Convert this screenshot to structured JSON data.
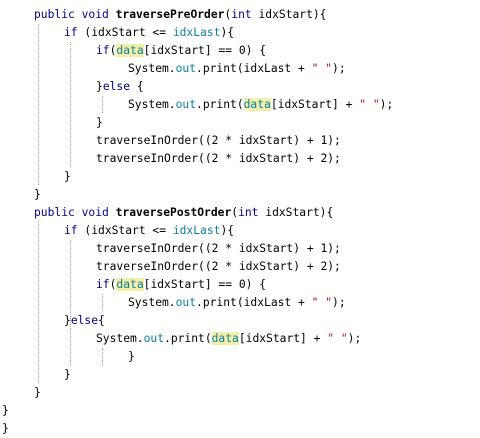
{
  "colors": {
    "keyword": "#00008b",
    "field": "#0b7fa0",
    "string": "#a31515",
    "highlight": "#f2f0a8",
    "guide": "#9a9a9a"
  },
  "code_lines": [
    {
      "indent": 34,
      "tokens": [
        {
          "t": "public void ",
          "c": "kw"
        },
        {
          "t": "traversePreOrder",
          "c": "bold"
        },
        {
          "t": "(",
          "c": ""
        },
        {
          "t": "int",
          "c": "kw"
        },
        {
          "t": " idxStart){",
          "c": ""
        }
      ]
    },
    {
      "indent": 64,
      "tokens": [
        {
          "t": "if",
          "c": "kw"
        },
        {
          "t": " (idxStart <= ",
          "c": ""
        },
        {
          "t": "idxLast",
          "c": "field"
        },
        {
          "t": "){",
          "c": ""
        }
      ]
    },
    {
      "indent": 96,
      "tokens": [
        {
          "t": "if",
          "c": "kw"
        },
        {
          "t": "(",
          "c": ""
        },
        {
          "t": "data",
          "c": "field hl"
        },
        {
          "t": "[idxStart] == 0) {",
          "c": ""
        }
      ]
    },
    {
      "indent": 128,
      "tokens": [
        {
          "t": "System.",
          "c": ""
        },
        {
          "t": "out",
          "c": "field"
        },
        {
          "t": ".print(idxLast + ",
          "c": ""
        },
        {
          "t": "\" \"",
          "c": "str"
        },
        {
          "t": ");",
          "c": ""
        }
      ]
    },
    {
      "indent": 96,
      "tokens": [
        {
          "t": "}",
          "c": ""
        },
        {
          "t": "else",
          "c": "kw"
        },
        {
          "t": " {",
          "c": ""
        }
      ]
    },
    {
      "indent": 128,
      "tokens": [
        {
          "t": "System.",
          "c": ""
        },
        {
          "t": "out",
          "c": "field"
        },
        {
          "t": ".print(",
          "c": ""
        },
        {
          "t": "data",
          "c": "field hl"
        },
        {
          "t": "[idxStart] + ",
          "c": ""
        },
        {
          "t": "\" \"",
          "c": "str"
        },
        {
          "t": ");",
          "c": ""
        }
      ]
    },
    {
      "indent": 96,
      "tokens": [
        {
          "t": "}",
          "c": ""
        }
      ]
    },
    {
      "indent": 96,
      "tokens": [
        {
          "t": "traverseInOrder((2 * idxStart) + 1);",
          "c": ""
        }
      ]
    },
    {
      "indent": 96,
      "tokens": [
        {
          "t": "traverseInOrder((2 * idxStart) + 2);",
          "c": ""
        }
      ]
    },
    {
      "indent": 64,
      "tokens": [
        {
          "t": "}",
          "c": ""
        }
      ]
    },
    {
      "indent": 34,
      "tokens": [
        {
          "t": "}",
          "c": ""
        }
      ]
    },
    {
      "indent": 34,
      "tokens": [
        {
          "t": "public void ",
          "c": "kw"
        },
        {
          "t": "traversePostOrder",
          "c": "bold"
        },
        {
          "t": "(",
          "c": ""
        },
        {
          "t": "int",
          "c": "kw"
        },
        {
          "t": " idxStart){",
          "c": ""
        }
      ]
    },
    {
      "indent": 64,
      "tokens": [
        {
          "t": "if",
          "c": "kw"
        },
        {
          "t": " (idxStart <= ",
          "c": ""
        },
        {
          "t": "idxLast",
          "c": "field"
        },
        {
          "t": "){",
          "c": ""
        }
      ]
    },
    {
      "indent": 96,
      "tokens": [
        {
          "t": "traverseInOrder((2 * idxStart) + 1);",
          "c": ""
        }
      ]
    },
    {
      "indent": 96,
      "tokens": [
        {
          "t": "traverseInOrder((2 * idxStart) + 2);",
          "c": ""
        }
      ]
    },
    {
      "indent": 96,
      "tokens": [
        {
          "t": "if",
          "c": "kw"
        },
        {
          "t": "(",
          "c": ""
        },
        {
          "t": "data",
          "c": "field hl"
        },
        {
          "t": "[idxStart] == 0) {",
          "c": ""
        }
      ]
    },
    {
      "indent": 128,
      "tokens": [
        {
          "t": "System.",
          "c": ""
        },
        {
          "t": "out",
          "c": "field"
        },
        {
          "t": ".print(idxLast + ",
          "c": ""
        },
        {
          "t": "\" \"",
          "c": "str"
        },
        {
          "t": ");",
          "c": ""
        }
      ]
    },
    {
      "indent": 64,
      "tokens": [
        {
          "t": "}",
          "c": ""
        },
        {
          "t": "else",
          "c": "kw"
        },
        {
          "t": "{",
          "c": ""
        }
      ]
    },
    {
      "indent": 96,
      "tokens": [
        {
          "t": "System.",
          "c": ""
        },
        {
          "t": "out",
          "c": "field"
        },
        {
          "t": ".print(",
          "c": ""
        },
        {
          "t": "data",
          "c": "field hl"
        },
        {
          "t": "[idxStart] + ",
          "c": ""
        },
        {
          "t": "\" \"",
          "c": "str"
        },
        {
          "t": ");",
          "c": ""
        }
      ]
    },
    {
      "indent": 128,
      "tokens": [
        {
          "t": "}",
          "c": ""
        }
      ]
    },
    {
      "indent": 64,
      "tokens": [
        {
          "t": "}",
          "c": ""
        }
      ]
    },
    {
      "indent": 34,
      "tokens": [
        {
          "t": "}",
          "c": ""
        }
      ]
    },
    {
      "indent": 2,
      "tokens": [
        {
          "t": "}",
          "c": ""
        }
      ]
    },
    {
      "indent": 2,
      "tokens": [
        {
          "t": "}",
          "c": ""
        }
      ]
    }
  ]
}
